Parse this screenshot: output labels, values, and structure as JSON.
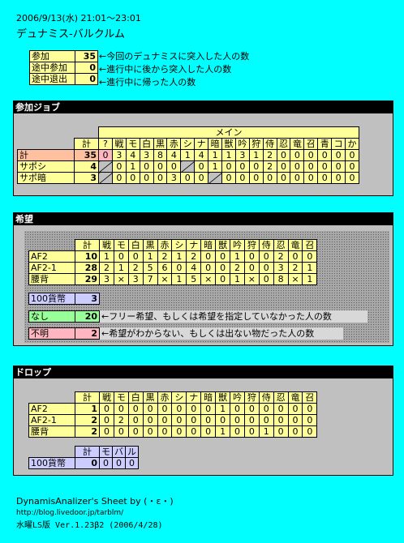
{
  "header": {
    "datetime": "2006/9/13(水) 21:01～23:01",
    "title": "デュナミス-バルクルム"
  },
  "summary": [
    {
      "label": "参加",
      "value": "35",
      "note": "←今回のデュナミスに突入した人の数"
    },
    {
      "label": "途中参加",
      "value": "0",
      "note": "←進行中に後から突入した人の数"
    },
    {
      "label": "途中退出",
      "value": "0",
      "note": "←進行中に帰った人の数"
    }
  ],
  "jobs": {
    "section_title": "参加ジョブ",
    "main_label": "メイン",
    "total_label": "計",
    "cols": [
      "?",
      "戦",
      "モ",
      "白",
      "黒",
      "赤",
      "シ",
      "ナ",
      "暗",
      "獣",
      "吟",
      "狩",
      "侍",
      "忍",
      "竜",
      "召",
      "青",
      "コ",
      "か"
    ],
    "rows": [
      {
        "label": "計",
        "total": "35",
        "cells": [
          "0",
          "3",
          "4",
          "3",
          "8",
          "4",
          "1",
          "4",
          "1",
          "1",
          "3",
          "1",
          "2",
          "0",
          "0",
          "0",
          "0",
          "0",
          "0"
        ]
      },
      {
        "label": "サポシ",
        "total": "4",
        "cells": [
          "",
          "0",
          "1",
          "0",
          "0",
          "0",
          "",
          "0",
          "1",
          "0",
          "0",
          "0",
          "2",
          "0",
          "0",
          "0",
          "0",
          "0",
          "0"
        ]
      },
      {
        "label": "サポ暗",
        "total": "3",
        "cells": [
          "",
          "0",
          "0",
          "0",
          "0",
          "3",
          "0",
          "0",
          "",
          "0",
          "0",
          "0",
          "0",
          "0",
          "0",
          "0",
          "0",
          "0",
          "0"
        ]
      }
    ]
  },
  "hope": {
    "section_title": "希望",
    "total_label": "計",
    "cols": [
      "戦",
      "モ",
      "白",
      "黒",
      "赤",
      "シ",
      "ナ",
      "暗",
      "獣",
      "吟",
      "狩",
      "侍",
      "忍",
      "竜",
      "召"
    ],
    "rows": [
      {
        "label": "AF2",
        "total": "10",
        "cells": [
          "1",
          "0",
          "0",
          "1",
          "2",
          "1",
          "2",
          "0",
          "0",
          "1",
          "0",
          "0",
          "2",
          "0",
          "0"
        ]
      },
      {
        "label": "AF2-1",
        "total": "28",
        "cells": [
          "2",
          "1",
          "2",
          "5",
          "6",
          "0",
          "4",
          "0",
          "0",
          "2",
          "0",
          "0",
          "3",
          "2",
          "1"
        ]
      },
      {
        "label": "腰背",
        "total": "29",
        "cells": [
          "3",
          "×",
          "3",
          "7",
          "×",
          "1",
          "5",
          "×",
          "0",
          "1",
          "×",
          "0",
          "8",
          "×",
          "1"
        ]
      }
    ],
    "currency": {
      "label": "100貨幣",
      "value": "3"
    },
    "none": {
      "label": "なし",
      "value": "20",
      "note": "←フリー希望、もしくは希望を指定していなかった人の数"
    },
    "unknown": {
      "label": "不明",
      "value": "2",
      "note": "←希望がわからない、もしくは出ない物だった人の数"
    }
  },
  "drop": {
    "section_title": "ドロップ",
    "total_label": "計",
    "cols": [
      "戦",
      "モ",
      "白",
      "黒",
      "赤",
      "シ",
      "ナ",
      "暗",
      "獣",
      "吟",
      "狩",
      "侍",
      "忍",
      "竜",
      "召"
    ],
    "rows": [
      {
        "label": "AF2",
        "total": "1",
        "cells": [
          "0",
          "0",
          "0",
          "0",
          "0",
          "0",
          "0",
          "0",
          "1",
          "0",
          "0",
          "0",
          "0",
          "0",
          "0"
        ]
      },
      {
        "label": "AF2-1",
        "total": "2",
        "cells": [
          "0",
          "2",
          "0",
          "0",
          "0",
          "0",
          "0",
          "0",
          "0",
          "0",
          "0",
          "0",
          "0",
          "0",
          "0"
        ]
      },
      {
        "label": "腰背",
        "total": "2",
        "cells": [
          "0",
          "0",
          "0",
          "0",
          "0",
          "0",
          "0",
          "0",
          "1",
          "0",
          "0",
          "1",
          "0",
          "0",
          "0"
        ]
      }
    ],
    "currency": {
      "header": [
        "計",
        "モ",
        "バ",
        "ル"
      ],
      "label": "100貨幣",
      "cells": [
        "0",
        "0",
        "0",
        "0"
      ]
    }
  },
  "footer": {
    "line1": "DynamisAnalizer's Sheet by (・ε・)",
    "line2": "http://blog.livedoor.jp/tarblm/",
    "line3": "水曜LS版 Ver.1.23β2 (2006/4/28)"
  }
}
